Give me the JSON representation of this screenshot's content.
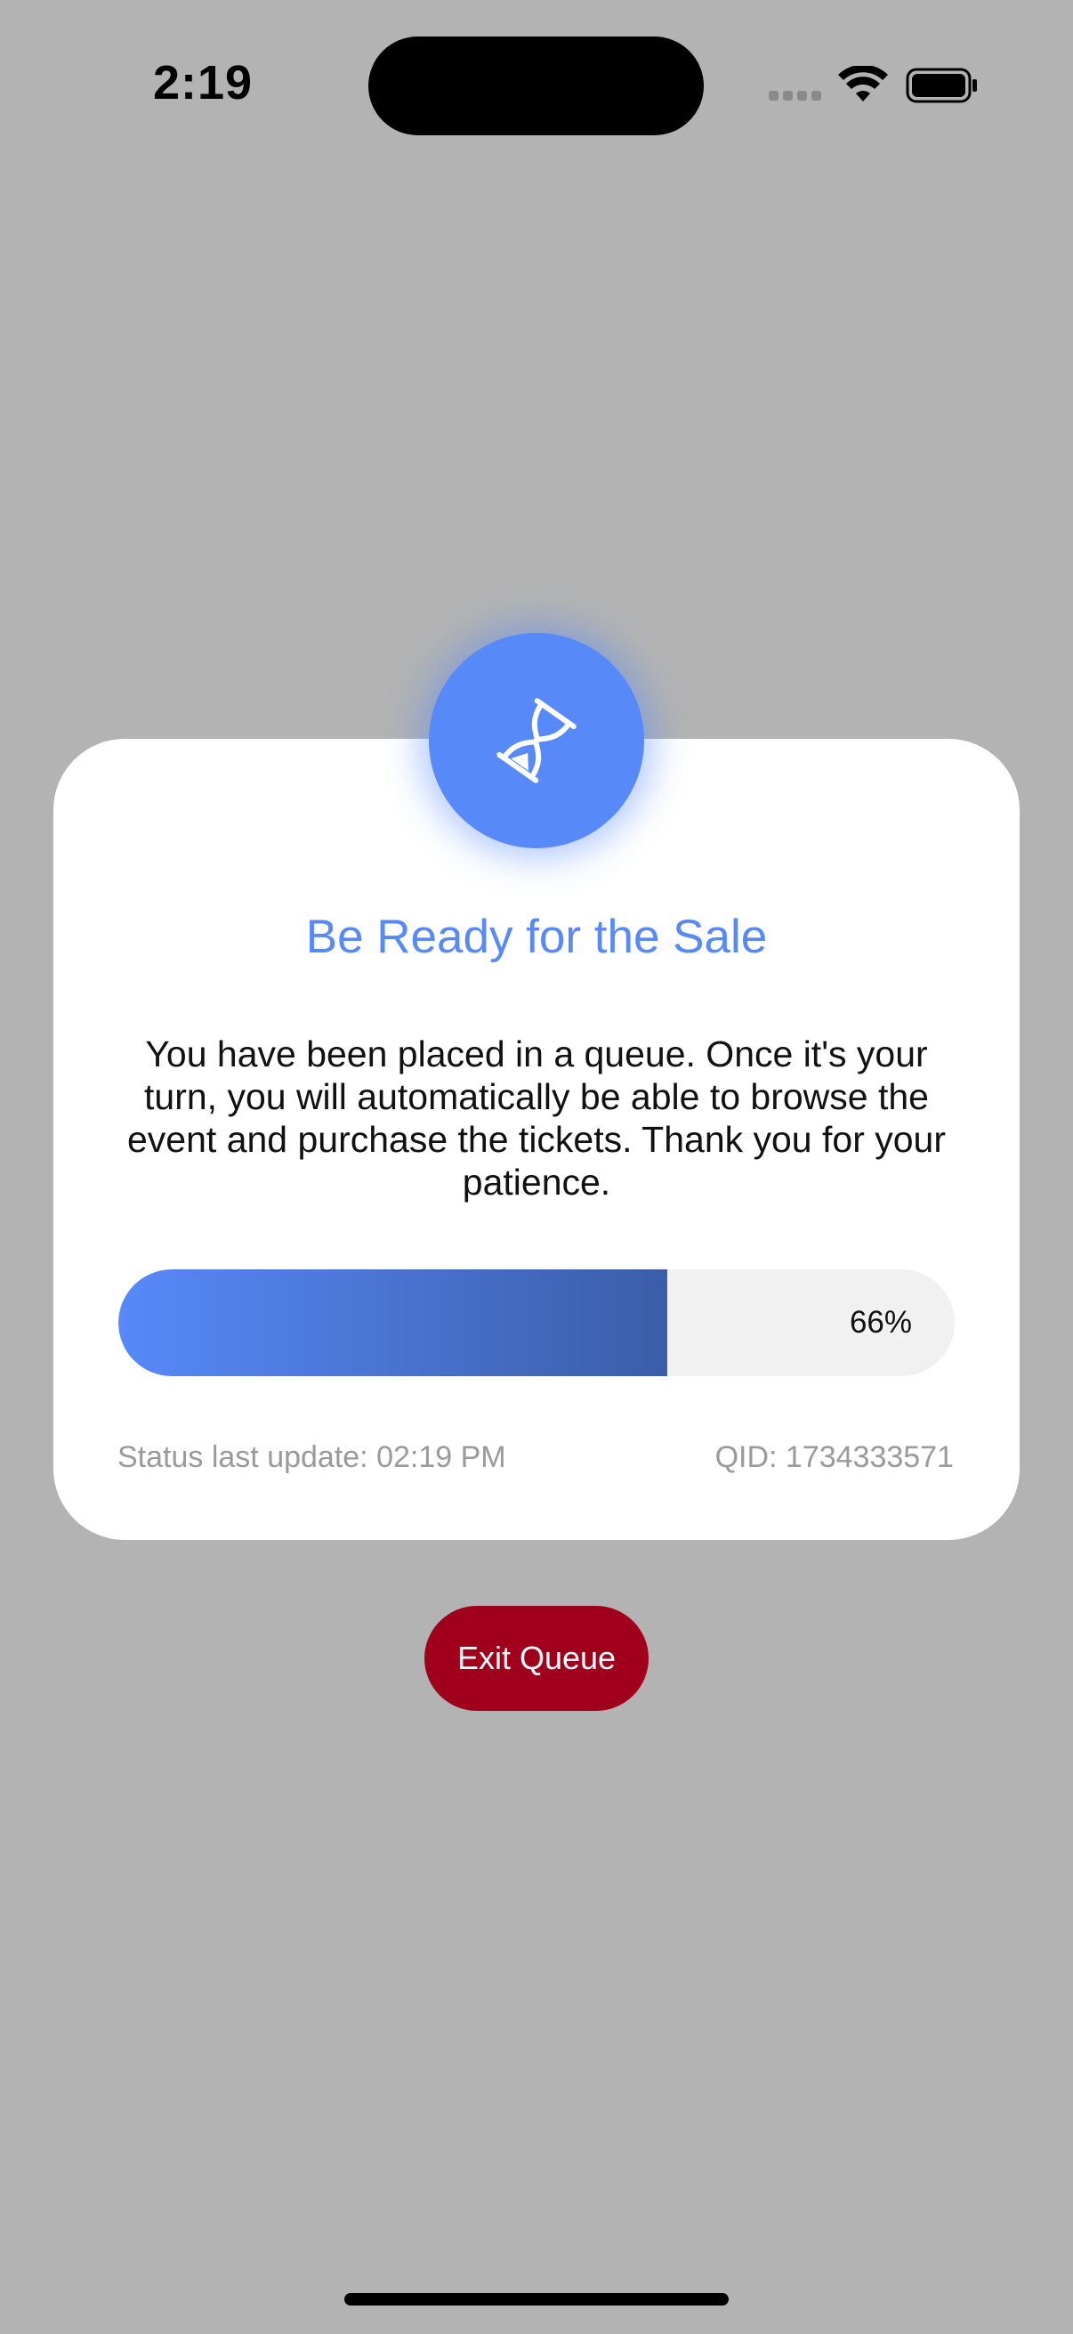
{
  "status_bar": {
    "time": "2:19"
  },
  "queue": {
    "title": "Be Ready for the Sale",
    "message": "You have been placed in a queue. Once it's your turn, you will automatically be able to browse the event and purchase the tickets. Thank you for your patience.",
    "progress_percent": 66,
    "progress_label": "66%",
    "status_last_update": "Status last update: 02:19 PM",
    "qid": "QID: 1734333571",
    "icon": "hourglass-icon"
  },
  "actions": {
    "exit_label": "Exit Queue"
  },
  "colors": {
    "background": "#b3b3b3",
    "accent": "#5789f9",
    "exit_button": "#a0001c"
  }
}
